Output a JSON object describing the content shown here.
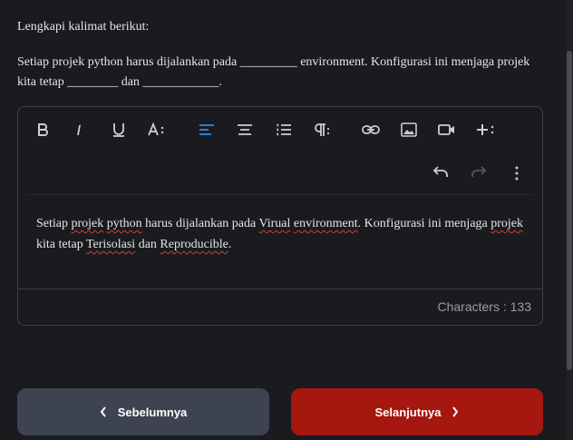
{
  "instruction": "Lengkapi kalimat berikut:",
  "question": {
    "line1": "Setiap projek python harus dijalankan pada _________ environment. Konfigurasi ini menjaga projek",
    "line2": "kita tetap ________ dan ____________."
  },
  "editor": {
    "toolbar_icons": [
      "bold-icon",
      "italic-icon",
      "underline-icon",
      "font-size-icon",
      "align-left-icon",
      "align-center-icon",
      "ordered-list-icon",
      "paragraph-format-icon",
      "link-icon",
      "image-icon",
      "video-icon",
      "more-insert-icon",
      "undo-icon",
      "redo-icon",
      "more-options-icon"
    ],
    "content": {
      "t1": "Setiap ",
      "w_projek": "projek",
      "t2": " ",
      "w_python": "python",
      "t3": " harus dijalankan pada ",
      "w_virual": "Virual",
      "t4": " ",
      "w_environment": "environment",
      "t5": ". Konfigurasi ini menjaga ",
      "w_projek2": "projek",
      "t6": " kita tetap ",
      "w_terisolasi": "Terisolasi",
      "t7": " dan ",
      "w_reproducible": "Reproducible",
      "t8": "."
    },
    "char_count": "Characters : 133"
  },
  "nav": {
    "prev_label": "Sebelumnya",
    "next_label": "Selanjutnya"
  },
  "colors": {
    "accent_active": "#2b8cf0",
    "next_button": "#a6170f",
    "prev_button": "#3d4350"
  }
}
